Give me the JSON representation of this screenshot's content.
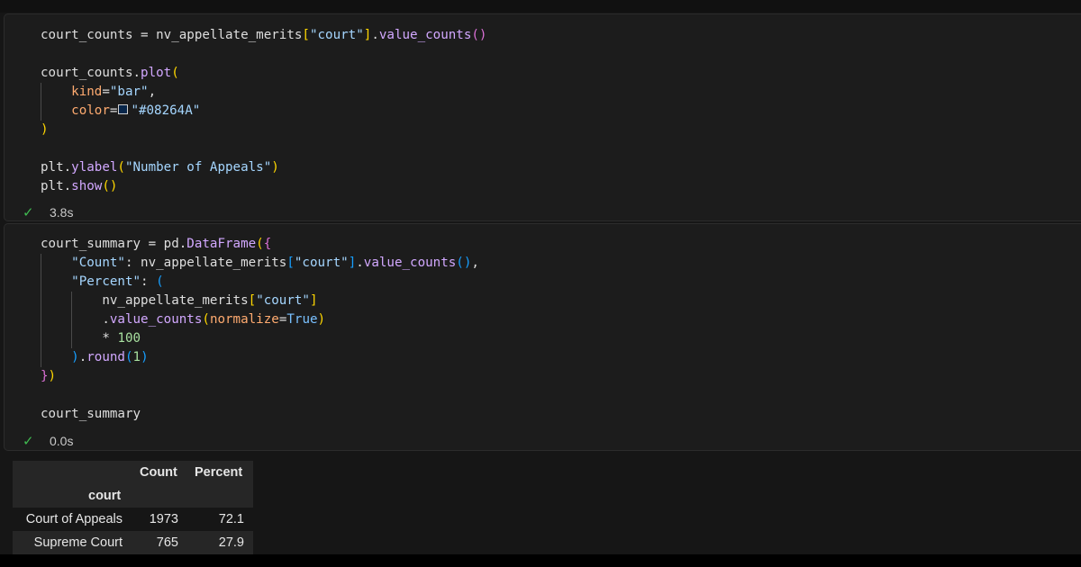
{
  "cell1": {
    "code_lines": [
      "court_counts = nv_appellate_merits[\"court\"].value_counts()",
      "",
      "court_counts.plot(",
      "    kind=\"bar\",",
      "    color=\"#08264A\"",
      ")",
      "",
      "plt.ylabel(\"Number of Appeals\")",
      "plt.show()"
    ],
    "color_swatch": "#08264A",
    "status_icon": "check-icon",
    "exec_time": "3.8s"
  },
  "cell2": {
    "code_lines": [
      "court_summary = pd.DataFrame({",
      "    \"Count\": nv_appellate_merits[\"court\"].value_counts(),",
      "    \"Percent\": (",
      "        nv_appellate_merits[\"court\"]",
      "        .value_counts(normalize=True)",
      "        * 100",
      "    ).round(1)",
      "})",
      "",
      "court_summary"
    ],
    "status_icon": "check-icon",
    "exec_time": "0.0s"
  },
  "output_table": {
    "columns": [
      "Count",
      "Percent"
    ],
    "index_name": "court",
    "rows": [
      {
        "index": "Court of Appeals",
        "count": "1973",
        "percent": "72.1"
      },
      {
        "index": "Supreme Court",
        "count": "765",
        "percent": "27.9"
      }
    ]
  },
  "colors": {
    "background": "#161616",
    "cell_background": "#1c1c1c",
    "success": "#3fb950"
  }
}
